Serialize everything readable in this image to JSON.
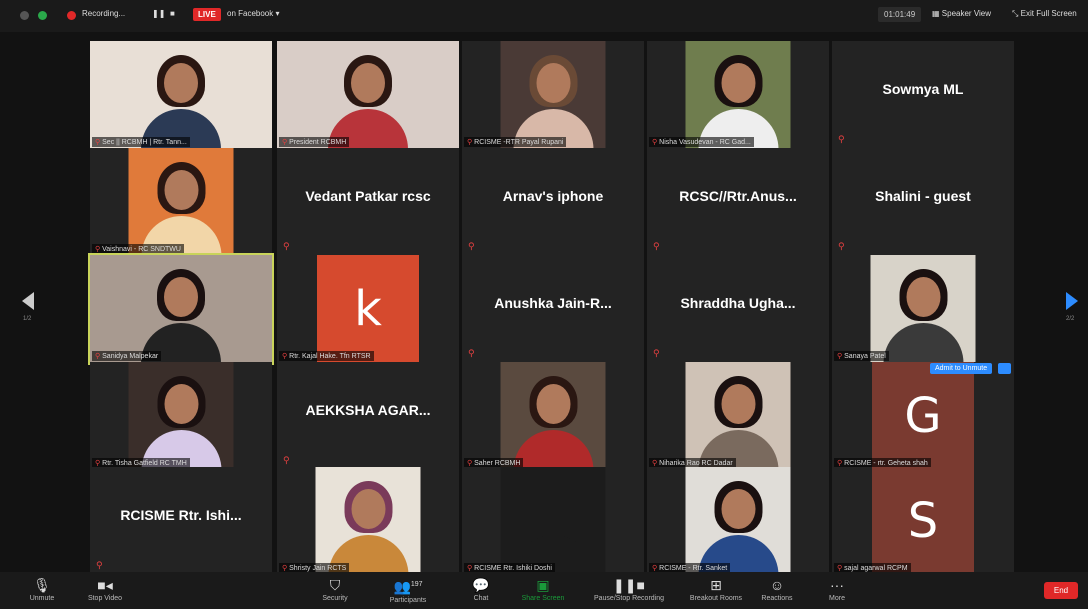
{
  "topbar": {
    "recording_label": "Recording...",
    "live_label": "LIVE",
    "live_platform": "on Facebook",
    "timer": "01:01:49",
    "speaker_view_label": "Speaker View",
    "exit_fullscreen_label": "Exit Full Screen"
  },
  "participants": [
    {
      "name": "Sec || RCBMH | Rtr. Tann...",
      "type": "video"
    },
    {
      "name": "President RCBMH",
      "type": "video"
    },
    {
      "name": "RCISME -RTR Payal Rupani",
      "type": "video"
    },
    {
      "name": "Nisha Vasudevan - RC Gad...",
      "type": "video"
    },
    {
      "name": "Sowmya ML",
      "type": "name"
    },
    {
      "name": "Vaishnavi - RC SNDTWU",
      "type": "video"
    },
    {
      "name": "Vedant Patkar rcsc",
      "type": "name"
    },
    {
      "name": "Arnav's iphone",
      "type": "name"
    },
    {
      "name": "RCSC//Rtr.Anus...",
      "type": "name"
    },
    {
      "name": "Shalini - guest",
      "type": "name"
    },
    {
      "name": "Sanidya Malpekar",
      "type": "video"
    },
    {
      "name": "Rtr. Kajal Hake. Tfn RTSR",
      "type": "avatar",
      "letter": "k"
    },
    {
      "name": "Anushka Jain-R...",
      "type": "name"
    },
    {
      "name": "Shraddha Ugha...",
      "type": "name"
    },
    {
      "name": "Sanaya Patel",
      "type": "video"
    },
    {
      "name": "Rtr. Tisha Gatfield RC TMH",
      "type": "video"
    },
    {
      "name": "AEKKSHA AGAR...",
      "type": "name"
    },
    {
      "name": "Saher RCBMH",
      "type": "video"
    },
    {
      "name": "Niharika Rao RC Dadar",
      "type": "video"
    },
    {
      "name": "RCISME - rtr. Geheta shah",
      "type": "avatar",
      "letter": "G"
    },
    {
      "name": "RCISME Rtr. Ishi...",
      "type": "name"
    },
    {
      "name": "Shristy Jain RCTS",
      "type": "video"
    },
    {
      "name": "RCISME Rtr. Ishiki Doshi",
      "type": "video"
    },
    {
      "name": "RCISME - Rtr. Sanket",
      "type": "video"
    },
    {
      "name": "sajal agarwal RCPM",
      "type": "avatar",
      "letter": "S"
    }
  ],
  "admit_label": "Admit to Unmute",
  "nav": {
    "prev_label": "1/2",
    "next_label": "2/2"
  },
  "controls": {
    "unmute": "Unmute",
    "stop_video": "Stop Video",
    "security": "Security",
    "participants": "Participants",
    "participants_count": "197",
    "chat": "Chat",
    "share_screen": "Share Screen",
    "pause_stop_recording": "Pause/Stop Recording",
    "breakout_rooms": "Breakout Rooms",
    "reactions": "Reactions",
    "more": "More",
    "end": "End"
  },
  "colors": {
    "accent_blue": "#2d8cff",
    "end_red": "#e02828",
    "active_border": "#c9d45a",
    "share_green": "#1a9a3a"
  }
}
